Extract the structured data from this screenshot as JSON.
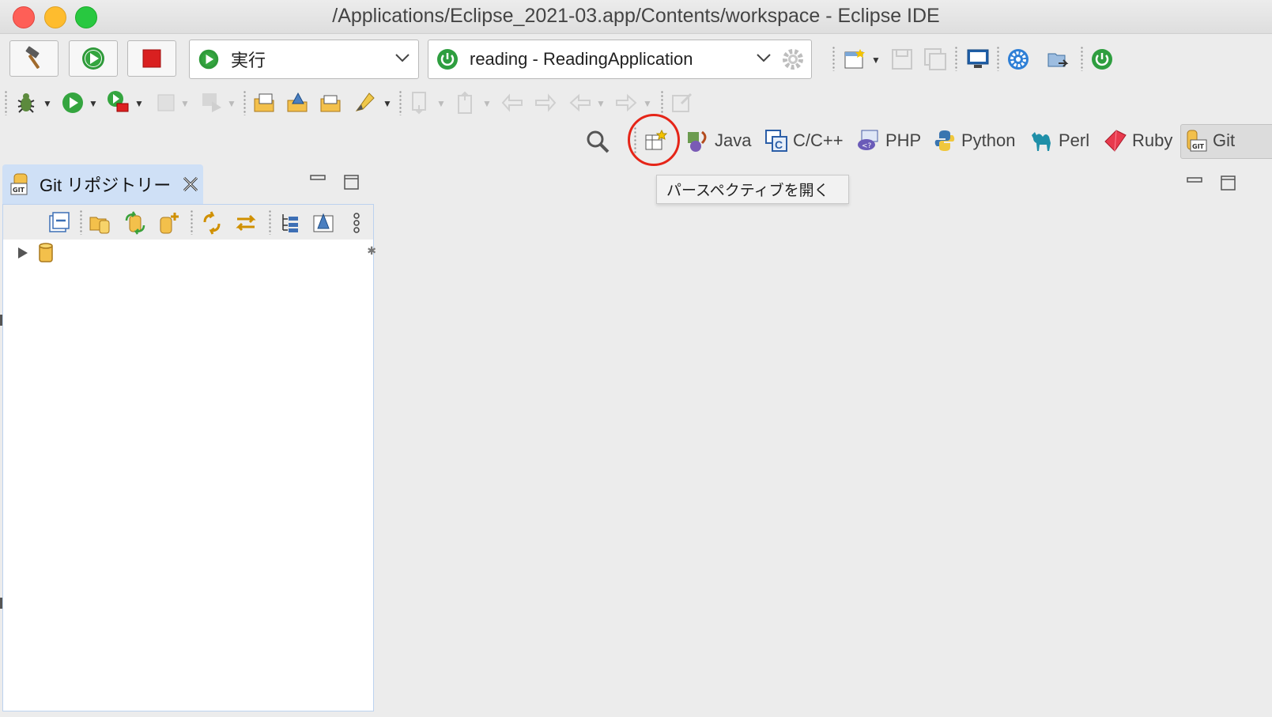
{
  "window": {
    "title": "/Applications/Eclipse_2021-03.app/Contents/workspace - Eclipse IDE"
  },
  "toolbar": {
    "run_config": "実行",
    "launch_target": "reading - ReadingApplication"
  },
  "perspectives": {
    "java": "Java",
    "cpp": "C/C++",
    "php": "PHP",
    "python": "Python",
    "perl": "Perl",
    "ruby": "Ruby",
    "git": "Git"
  },
  "tooltip": {
    "text": "パースペクティブを開く"
  },
  "git_view": {
    "title": "Git リポジトリー"
  },
  "colors": {
    "highlight_circle": "#e52518",
    "view_tab_active": "#cfe0f6",
    "spring_green": "#2e9e3f"
  }
}
